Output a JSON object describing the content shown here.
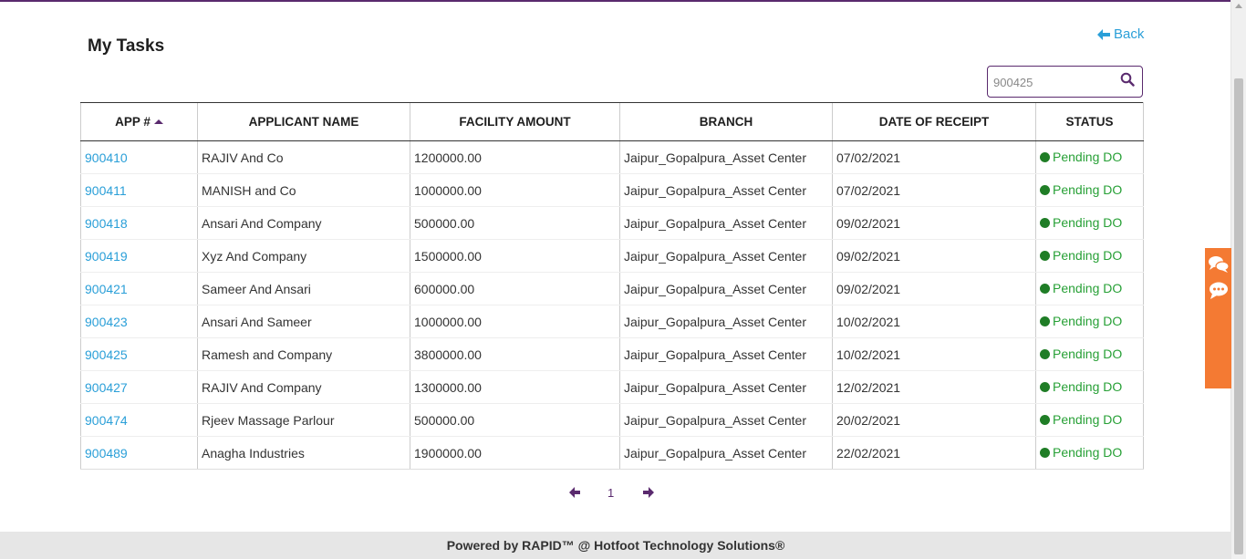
{
  "page": {
    "title": "My Tasks",
    "back_label": "Back"
  },
  "search": {
    "value": "900425",
    "placeholder": ""
  },
  "table": {
    "headers": [
      "APP #",
      "APPLICANT NAME",
      "FACILITY AMOUNT",
      "BRANCH",
      "DATE OF RECEIPT",
      "STATUS"
    ],
    "rows": [
      {
        "app": "900410",
        "name": "RAJIV And Co",
        "amount": "1200000.00",
        "branch": "Jaipur_Gopalpura_Asset Center",
        "date": "07/02/2021",
        "status": "Pending DO"
      },
      {
        "app": "900411",
        "name": "MANISH and Co",
        "amount": "1000000.00",
        "branch": "Jaipur_Gopalpura_Asset Center",
        "date": "07/02/2021",
        "status": "Pending DO"
      },
      {
        "app": "900418",
        "name": "Ansari And Company",
        "amount": "500000.00",
        "branch": "Jaipur_Gopalpura_Asset Center",
        "date": "09/02/2021",
        "status": "Pending DO"
      },
      {
        "app": "900419",
        "name": "Xyz And Company",
        "amount": "1500000.00",
        "branch": "Jaipur_Gopalpura_Asset Center",
        "date": "09/02/2021",
        "status": "Pending DO"
      },
      {
        "app": "900421",
        "name": "Sameer And Ansari",
        "amount": "600000.00",
        "branch": "Jaipur_Gopalpura_Asset Center",
        "date": "09/02/2021",
        "status": "Pending DO"
      },
      {
        "app": "900423",
        "name": "Ansari And Sameer",
        "amount": "1000000.00",
        "branch": "Jaipur_Gopalpura_Asset Center",
        "date": "10/02/2021",
        "status": "Pending DO"
      },
      {
        "app": "900425",
        "name": "Ramesh and Company",
        "amount": "3800000.00",
        "branch": "Jaipur_Gopalpura_Asset Center",
        "date": "10/02/2021",
        "status": "Pending DO"
      },
      {
        "app": "900427",
        "name": "RAJIV And Company",
        "amount": "1300000.00",
        "branch": "Jaipur_Gopalpura_Asset Center",
        "date": "12/02/2021",
        "status": "Pending DO"
      },
      {
        "app": "900474",
        "name": "Rjeev Massage Parlour",
        "amount": "500000.00",
        "branch": "Jaipur_Gopalpura_Asset Center",
        "date": "20/02/2021",
        "status": "Pending DO"
      },
      {
        "app": "900489",
        "name": "Anagha Industries",
        "amount": "1900000.00",
        "branch": "Jaipur_Gopalpura_Asset Center",
        "date": "22/02/2021",
        "status": "Pending DO"
      }
    ]
  },
  "pagination": {
    "current_page": "1"
  },
  "footer": {
    "text": "Powered by RAPID™ @ Hotfoot Technology Solutions®"
  },
  "colors": {
    "accent": "#5a2a6e",
    "link": "#2a9fd8",
    "status_green": "#27a036",
    "widget_orange": "#f47a33"
  },
  "icons": {
    "back": "arrow-left-icon",
    "search": "search-icon",
    "prev": "arrow-left-icon",
    "next": "arrow-right-icon",
    "widget": "chat-bubbles-icon"
  }
}
